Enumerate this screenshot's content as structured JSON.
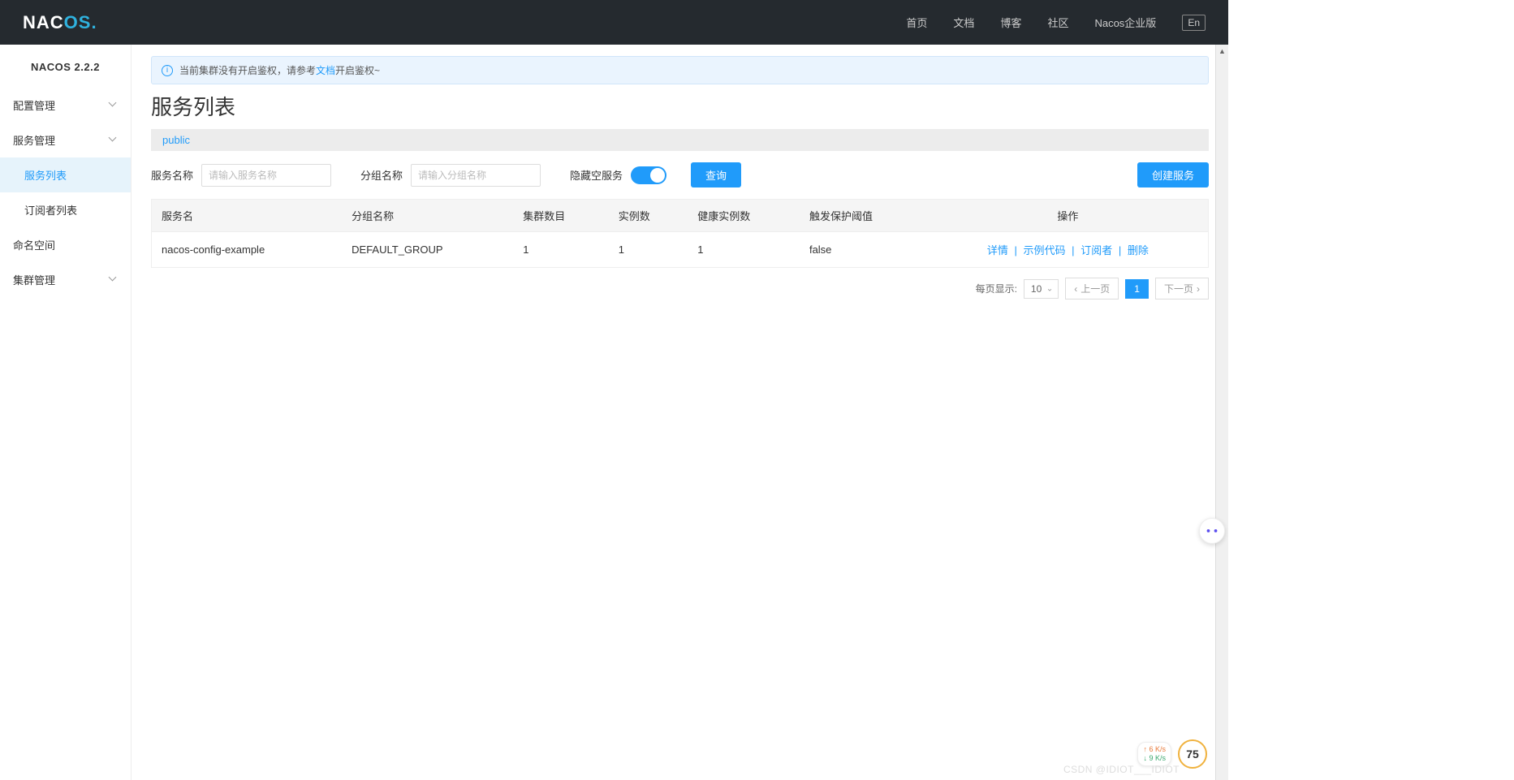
{
  "header": {
    "logo_pre": "NAC",
    "logo_co": "OS",
    "logo_dot": ".",
    "nav": [
      "首页",
      "文档",
      "博客",
      "社区",
      "Nacos企业版"
    ],
    "lang": "En"
  },
  "sidebar": {
    "title": "NACOS 2.2.2",
    "items": [
      {
        "label": "配置管理",
        "hasChevron": true
      },
      {
        "label": "服务管理",
        "hasChevron": true
      },
      {
        "label": "服务列表",
        "child": true,
        "active": true
      },
      {
        "label": "订阅者列表",
        "child": true
      },
      {
        "label": "命名空间"
      },
      {
        "label": "集群管理",
        "hasChevron": true
      }
    ]
  },
  "alert": {
    "text_before": "当前集群没有开启鉴权，请参考",
    "link": "文档",
    "text_after": "开启鉴权~"
  },
  "page_title": "服务列表",
  "namespace": "public",
  "filters": {
    "service_label": "服务名称",
    "service_placeholder": "请输入服务名称",
    "group_label": "分组名称",
    "group_placeholder": "请输入分组名称",
    "hide_empty_label": "隐藏空服务",
    "query_btn": "查询",
    "create_btn": "创建服务"
  },
  "table": {
    "columns": [
      "服务名",
      "分组名称",
      "集群数目",
      "实例数",
      "健康实例数",
      "触发保护阈值",
      "操作"
    ],
    "rows": [
      {
        "service_name": "nacos-config-example",
        "group_name": "DEFAULT_GROUP",
        "cluster_count": "1",
        "instance_count": "1",
        "healthy_count": "1",
        "threshold": "false",
        "actions": [
          "详情",
          "示例代码",
          "订阅者",
          "删除"
        ]
      }
    ]
  },
  "pagination": {
    "per_page_label": "每页显示:",
    "per_page_value": "10",
    "prev": "上一页",
    "current": "1",
    "next": "下一页"
  },
  "widgets": {
    "net_up": "↑ 6  K/s",
    "net_down": "↓ 9  K/s",
    "score": "75"
  },
  "watermark": "CSDN @IDIOT___IDIOT"
}
